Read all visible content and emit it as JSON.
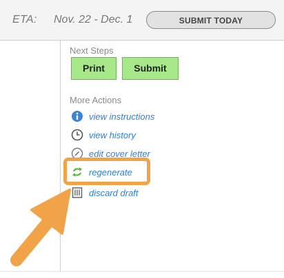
{
  "header": {
    "eta_label": "ETA:",
    "eta_value": "Nov. 22 - Dec. 1",
    "submit_today_label": "SUBMIT TODAY"
  },
  "next_steps": {
    "label": "Next Steps",
    "print_label": "Print",
    "submit_label": "Submit"
  },
  "more_actions": {
    "label": "More Actions",
    "items": [
      {
        "label": "view instructions",
        "icon": "info-icon"
      },
      {
        "label": "view history",
        "icon": "clock-icon"
      },
      {
        "label": "edit cover letter",
        "icon": "pencil-icon"
      },
      {
        "label": "regenerate",
        "icon": "refresh-icon"
      },
      {
        "label": "discard draft",
        "icon": "trash-icon"
      }
    ]
  },
  "colors": {
    "accent_green": "#a7e98a",
    "link_blue": "#2f7fd4",
    "highlight_orange": "#f0a347"
  }
}
